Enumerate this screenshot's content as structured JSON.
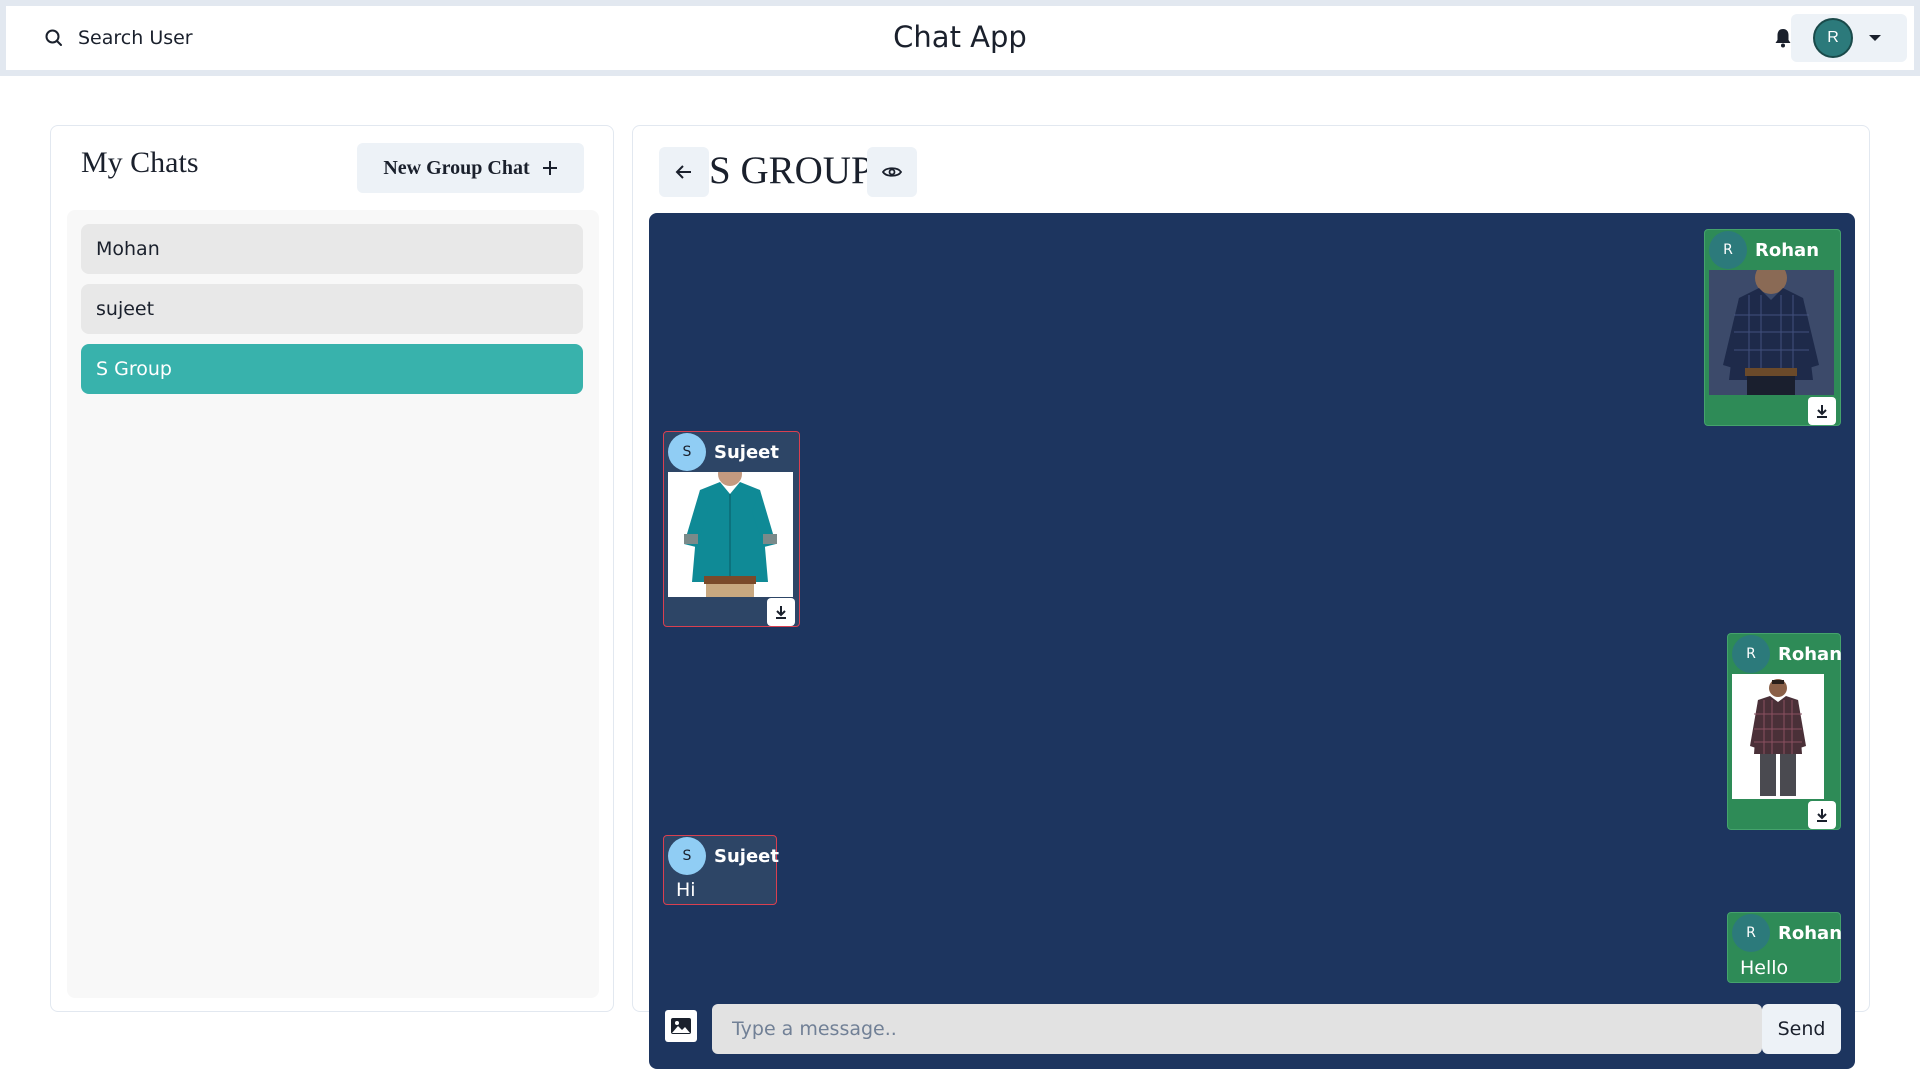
{
  "header": {
    "search_label": "Search User",
    "app_title": "Chat App",
    "user_avatar_initial": "R"
  },
  "sidebar": {
    "title": "My Chats",
    "new_group_label": "New Group Chat",
    "chats": [
      {
        "name": "Mohan",
        "active": false
      },
      {
        "name": "sujeet",
        "active": false
      },
      {
        "name": "S Group",
        "active": true
      }
    ]
  },
  "chat": {
    "title": "S GROUP",
    "messages": [
      {
        "sender": "Rohan",
        "initial": "R",
        "mine": true,
        "type": "image",
        "image": "navy-check-shirt-photo"
      },
      {
        "sender": "Sujeet",
        "initial": "S",
        "mine": false,
        "type": "image",
        "image": "teal-shirt-photo"
      },
      {
        "sender": "Rohan",
        "initial": "R",
        "mine": true,
        "type": "image",
        "image": "plaid-shirt-photo"
      },
      {
        "sender": "Sujeet",
        "initial": "S",
        "mine": false,
        "type": "text",
        "text": "Hi"
      },
      {
        "sender": "Rohan",
        "initial": "R",
        "mine": true,
        "type": "text",
        "text": "Hello"
      }
    ],
    "input_placeholder": "Type a message..",
    "send_label": "Send"
  },
  "colors": {
    "accent": "#38b2ac",
    "chat_bg": "#1d355f",
    "mine_bubble": "#2e8b57",
    "other_bubble": "#2d4566",
    "other_border": "#d94050"
  }
}
